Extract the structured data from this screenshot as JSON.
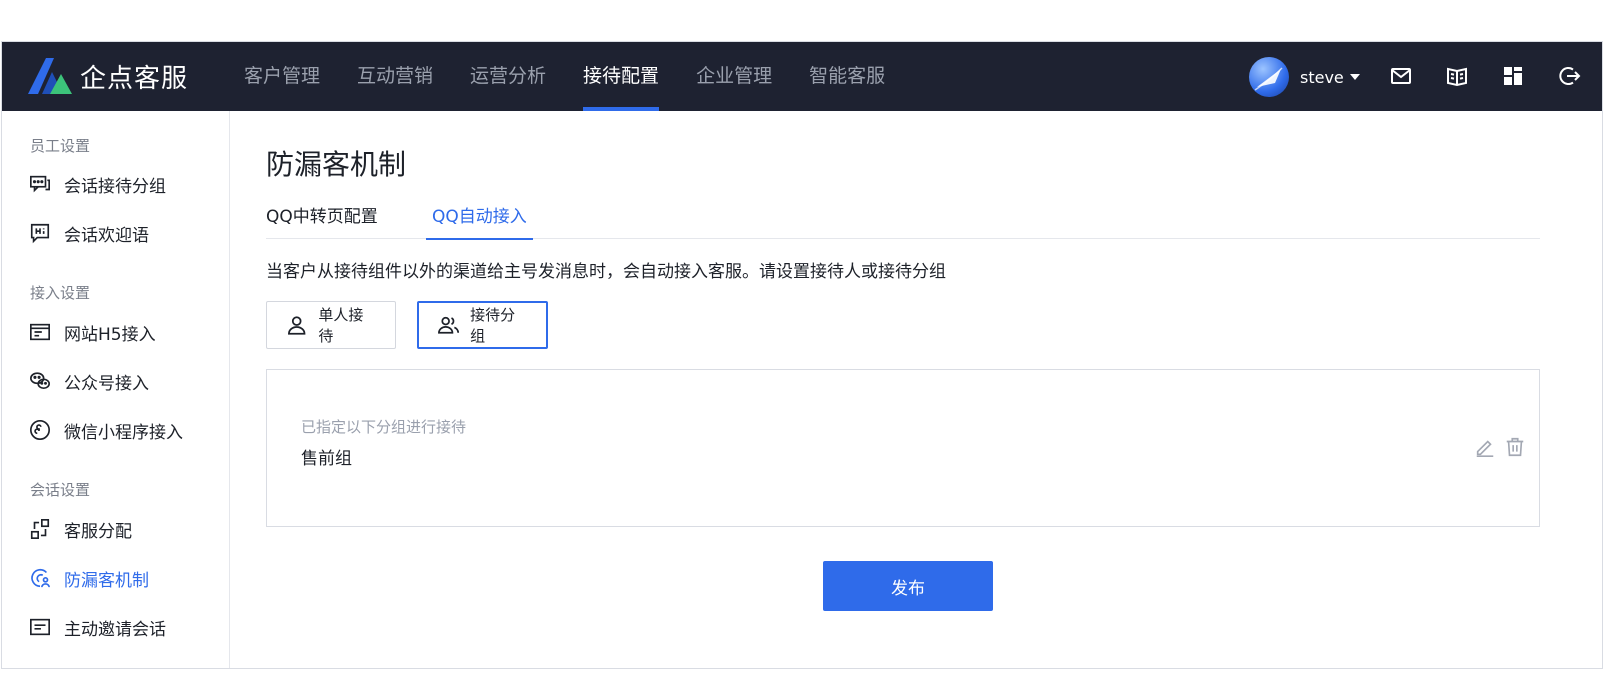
{
  "brand": {
    "name": "企点客服"
  },
  "nav": {
    "items": [
      {
        "label": "客户管理"
      },
      {
        "label": "互动营销"
      },
      {
        "label": "运营分析"
      },
      {
        "label": "接待配置"
      },
      {
        "label": "企业管理"
      },
      {
        "label": "智能客服"
      }
    ],
    "active_index": 3
  },
  "user": {
    "name": "steve"
  },
  "top_icons": [
    "mail-icon",
    "book-icon",
    "apps-grid-icon",
    "logout-icon"
  ],
  "sidebar": {
    "groups": [
      {
        "label": "员工设置"
      },
      {
        "label": "接入设置"
      },
      {
        "label": "会话设置"
      }
    ],
    "items": [
      {
        "label": "会话接待分组",
        "icon": "chat-group-icon"
      },
      {
        "label": "会话欢迎语",
        "icon": "hi-message-icon"
      },
      {
        "label": "网站H5接入",
        "icon": "web-page-icon"
      },
      {
        "label": "公众号接入",
        "icon": "wechat-icon"
      },
      {
        "label": "微信小程序接入",
        "icon": "mini-program-icon"
      },
      {
        "label": "客服分配",
        "icon": "distribute-icon"
      },
      {
        "label": "防漏客机制",
        "icon": "anti-leak-icon"
      },
      {
        "label": "主动邀请会话",
        "icon": "invite-icon"
      }
    ],
    "active_index": 6
  },
  "main": {
    "title": "防漏客机制",
    "tabs": [
      {
        "label": "QQ中转页配置"
      },
      {
        "label": "QQ自动接入"
      }
    ],
    "active_tab": 1,
    "description": "当客户从接待组件以外的渠道给主号发消息时，会自动接入客服。请设置接待人或接待分组",
    "modes": [
      {
        "label": "单人接待",
        "icon": "person-icon"
      },
      {
        "label": "接待分组",
        "icon": "people-group-icon"
      }
    ],
    "selected_mode": 1,
    "card": {
      "hint": "已指定以下分组进行接待",
      "value": "售前组"
    },
    "publish_label": "发布"
  },
  "colors": {
    "topbar_bg": "#1e2231",
    "accent": "#2f6bea",
    "logo_blue": "#2f6bea",
    "logo_green": "#3cc37a"
  }
}
